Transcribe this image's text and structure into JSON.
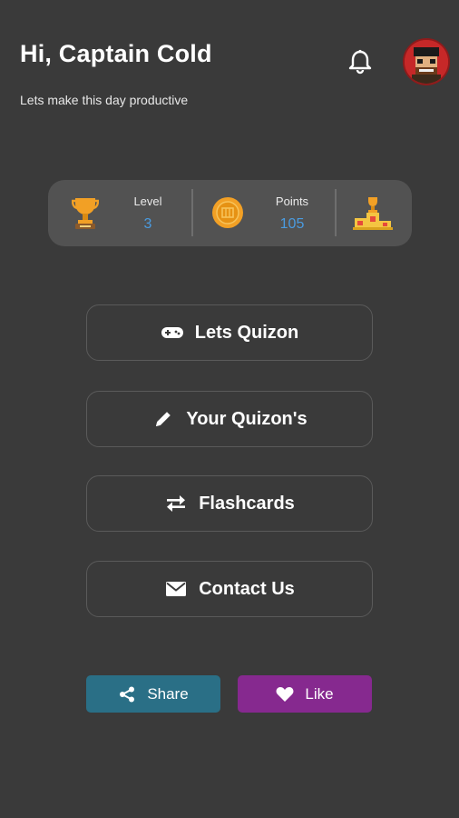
{
  "header": {
    "greeting": "Hi, Captain Cold",
    "subtitle": "Lets make this day productive"
  },
  "icons": {
    "notification": "bell-icon",
    "avatar": "avatar"
  },
  "stats": {
    "level_label": "Level",
    "level_value": "3",
    "points_label": "Points",
    "points_value": "105"
  },
  "menu": [
    {
      "label": "Lets Quizon",
      "icon": "gamepad-icon"
    },
    {
      "label": "Your Quizon's",
      "icon": "pencil-icon"
    },
    {
      "label": "Flashcards",
      "icon": "swap-arrows-icon"
    },
    {
      "label": "Contact Us",
      "icon": "envelope-icon"
    }
  ],
  "actions": {
    "share_label": "Share",
    "like_label": "Like"
  },
  "colors": {
    "background": "#3a3a3a",
    "card": "#525252",
    "stat_value": "#4a9be0",
    "share": "#2a6f86",
    "like": "#86298f"
  }
}
